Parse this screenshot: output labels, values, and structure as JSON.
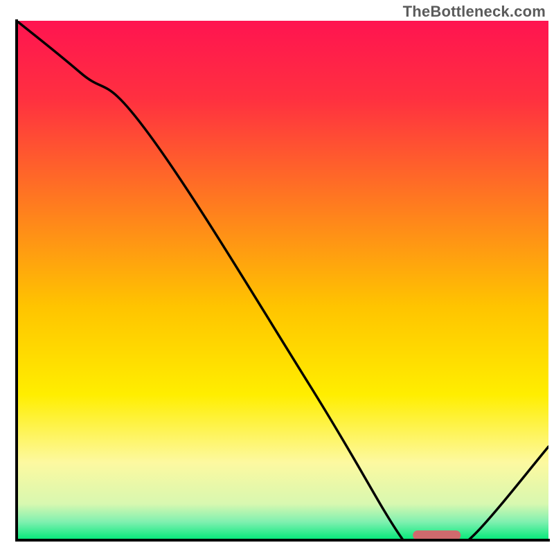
{
  "watermark": "TheBottleneck.com",
  "chart_data": {
    "type": "line",
    "title": "",
    "xlabel": "",
    "ylabel": "",
    "xlim": [
      0,
      100
    ],
    "ylim": [
      0,
      100
    ],
    "series": [
      {
        "name": "curve",
        "x": [
          0,
          12,
          25,
          55,
          72,
          75,
          82,
          86,
          100
        ],
        "y": [
          100,
          90,
          78,
          30,
          1,
          0,
          0,
          1,
          18
        ]
      }
    ],
    "marker": {
      "x_center": 79,
      "width": 9,
      "color": "#cf6a6d"
    },
    "gradient_stops": [
      {
        "offset": 0.0,
        "color": "#ff1450"
      },
      {
        "offset": 0.15,
        "color": "#ff3040"
      },
      {
        "offset": 0.35,
        "color": "#ff7a20"
      },
      {
        "offset": 0.55,
        "color": "#ffc400"
      },
      {
        "offset": 0.72,
        "color": "#ffee00"
      },
      {
        "offset": 0.85,
        "color": "#fdf9a0"
      },
      {
        "offset": 0.93,
        "color": "#d8f8b0"
      },
      {
        "offset": 0.965,
        "color": "#7ff0b0"
      },
      {
        "offset": 1.0,
        "color": "#00e878"
      }
    ],
    "axis_color": "#000000",
    "axis_width": 4
  }
}
